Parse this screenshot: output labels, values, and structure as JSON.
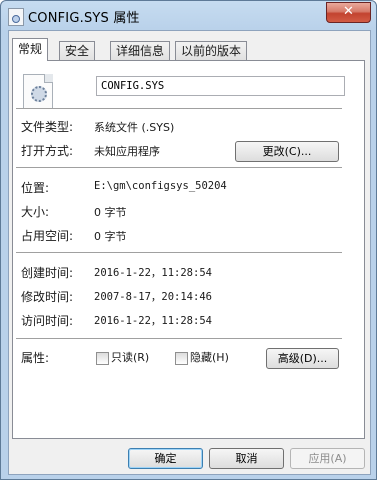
{
  "window": {
    "title": "CONFIG.SYS 属性",
    "close_glyph": "✕"
  },
  "tabs": [
    {
      "label": "常规",
      "active": true
    },
    {
      "label": "安全",
      "active": false
    },
    {
      "label": "详细信息",
      "active": false
    },
    {
      "label": "以前的版本",
      "active": false
    }
  ],
  "general": {
    "file_name": "CONFIG.SYS",
    "file_type_label": "文件类型:",
    "file_type_value": "系统文件 (.SYS)",
    "open_with_label": "打开方式:",
    "open_with_value": "未知应用程序",
    "change_button": "更改(C)...",
    "location_label": "位置:",
    "location_value": "E:\\gm\\configsys_50204",
    "size_label": "大小:",
    "size_value": "0 字节",
    "disk_size_label": "占用空间:",
    "disk_size_value": "0 字节",
    "created_label": "创建时间:",
    "created_value": "2016-1-22，11:28:54",
    "modified_label": "修改时间:",
    "modified_value": "2007-8-17，20:14:46",
    "accessed_label": "访问时间:",
    "accessed_value": "2016-1-22，11:28:54",
    "attributes_label": "属性:",
    "readonly_label": "只读(R)",
    "readonly_checked": false,
    "hidden_label": "隐藏(H)",
    "hidden_checked": false,
    "advanced_button": "高级(D)..."
  },
  "footer": {
    "ok_button": "确定",
    "cancel_button": "取消",
    "apply_button": "应用(A)",
    "apply_enabled": false
  }
}
